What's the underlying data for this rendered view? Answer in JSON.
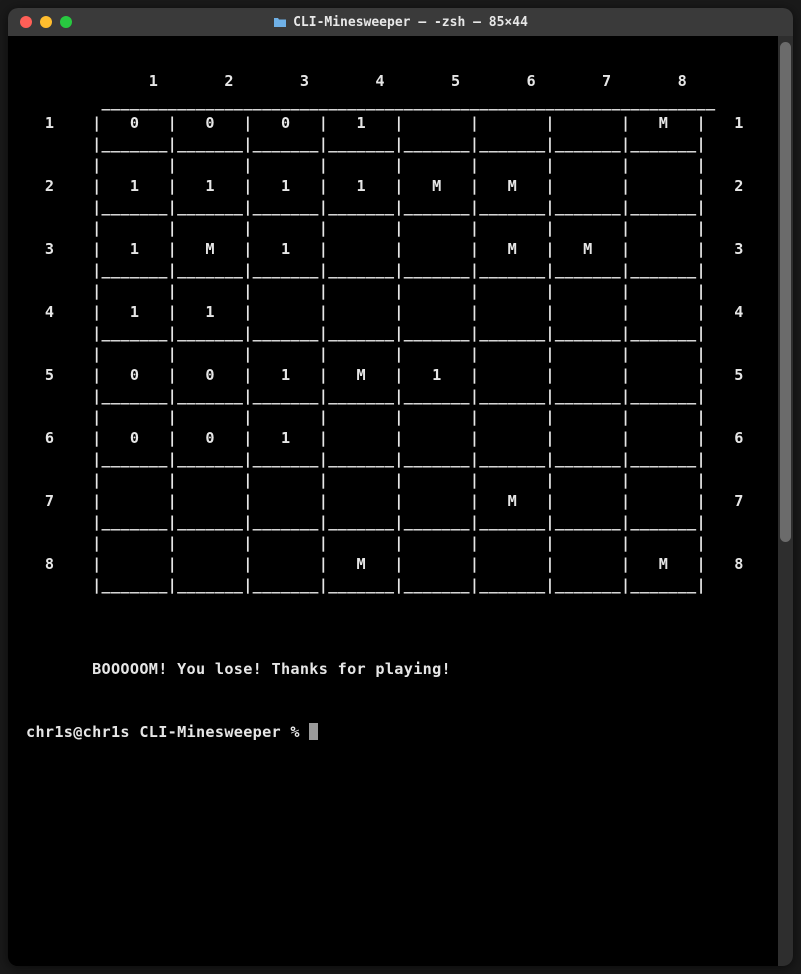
{
  "window": {
    "title": "CLI-Minesweeper — -zsh — 85×44"
  },
  "game": {
    "col_labels": [
      "1",
      "2",
      "3",
      "4",
      "5",
      "6",
      "7",
      "8"
    ],
    "row_labels": [
      "1",
      "2",
      "3",
      "4",
      "5",
      "6",
      "7",
      "8"
    ],
    "board": [
      [
        "0",
        "0",
        "0",
        "1",
        " ",
        " ",
        " ",
        "M"
      ],
      [
        "1",
        "1",
        "1",
        "1",
        "M",
        "M",
        " ",
        " "
      ],
      [
        "1",
        "M",
        "1",
        " ",
        " ",
        "M",
        "M",
        " "
      ],
      [
        "1",
        "1",
        " ",
        " ",
        " ",
        " ",
        " ",
        " "
      ],
      [
        "0",
        "0",
        "1",
        "M",
        "1",
        " ",
        " ",
        " "
      ],
      [
        "0",
        "0",
        "1",
        " ",
        " ",
        " ",
        " ",
        " "
      ],
      [
        " ",
        " ",
        " ",
        " ",
        " ",
        "M",
        " ",
        " "
      ],
      [
        " ",
        " ",
        " ",
        "M",
        " ",
        " ",
        " ",
        "M"
      ]
    ],
    "status": "BOOOOOM! You lose! Thanks for playing!"
  },
  "prompt": {
    "text": "chr1s@chr1s CLI-Minesweeper % "
  }
}
